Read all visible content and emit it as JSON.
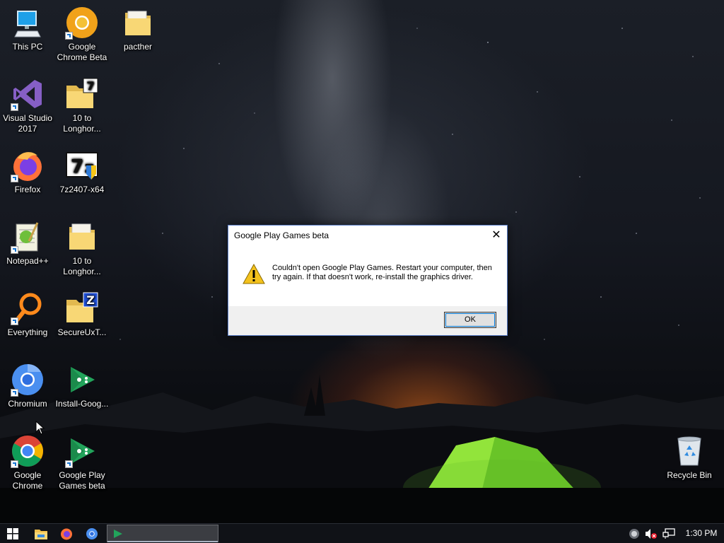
{
  "desktop": {
    "icons": [
      {
        "name": "this-pc",
        "label": "This PC"
      },
      {
        "name": "google-chrome-beta",
        "label": "Google Chrome Beta"
      },
      {
        "name": "pacther",
        "label": "pacther"
      },
      {
        "name": "visual-studio-2017",
        "label": "Visual Studio 2017"
      },
      {
        "name": "10-to-longhorn-1",
        "label": "10 to Longhor..."
      },
      {
        "name": "firefox",
        "label": "Firefox"
      },
      {
        "name": "7z2407-x64",
        "label": "7z2407-x64"
      },
      {
        "name": "notepad-plus-plus",
        "label": "Notepad++"
      },
      {
        "name": "10-to-longhorn-2",
        "label": "10 to Longhor..."
      },
      {
        "name": "everything",
        "label": "Everything"
      },
      {
        "name": "secureuxt",
        "label": "SecureUxT..."
      },
      {
        "name": "chromium",
        "label": "Chromium"
      },
      {
        "name": "install-google",
        "label": "Install-Goog..."
      },
      {
        "name": "google-chrome",
        "label": "Google Chrome"
      },
      {
        "name": "google-play-games-beta",
        "label": "Google Play Games beta"
      },
      {
        "name": "recycle-bin",
        "label": "Recycle Bin"
      }
    ]
  },
  "dialog": {
    "title": "Google Play Games beta",
    "close_glyph": "✕",
    "message": "Couldn't open Google Play Games. Restart your computer, then try again. If that doesn't work, re-install the graphics driver.",
    "ok_label": "OK"
  },
  "taskbar": {
    "clock": "1:30 PM"
  },
  "colors": {
    "dialog_border": "#5a7ec7",
    "taskbar_bg": "#101217",
    "warning_yellow": "#f4c21d"
  }
}
